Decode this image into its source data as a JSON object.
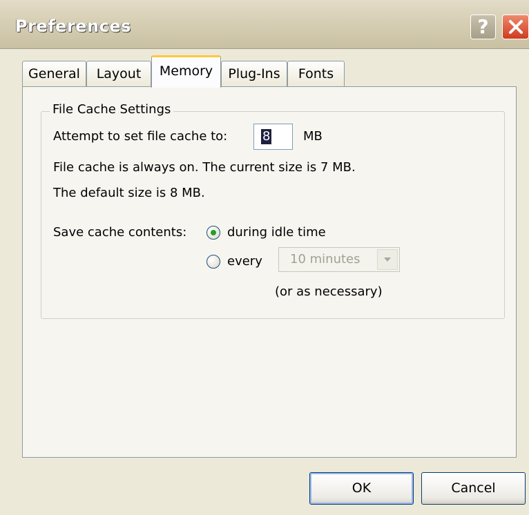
{
  "window": {
    "title": "Preferences",
    "help_label": "?",
    "icons": {
      "help": "question-mark-icon",
      "close": "close-x-icon"
    },
    "colors": {
      "background": "#ece9d8",
      "close": "#cf3b1e",
      "active_tab_accent": "#ffc83c"
    }
  },
  "tabs": [
    {
      "label": "General",
      "active": false
    },
    {
      "label": "Layout",
      "active": false
    },
    {
      "label": "Memory",
      "active": true
    },
    {
      "label": "Plug-Ins",
      "active": false
    },
    {
      "label": "Fonts",
      "active": false
    }
  ],
  "file_cache": {
    "group_title": "File Cache Settings",
    "attempt_label": "Attempt to set file cache to:",
    "cache_value": "8",
    "unit": "MB",
    "status_line": "File cache is always on.  The current size is 7 MB.",
    "default_line": "The default size is 8 MB.",
    "save_label": "Save cache contents:",
    "option_idle": {
      "label": "during idle time",
      "selected": true
    },
    "option_every": {
      "label": "every",
      "selected": false
    },
    "interval": {
      "selected": "10 minutes",
      "disabled": true
    },
    "note": "(or as necessary)"
  },
  "buttons": {
    "ok": "OK",
    "cancel": "Cancel"
  }
}
